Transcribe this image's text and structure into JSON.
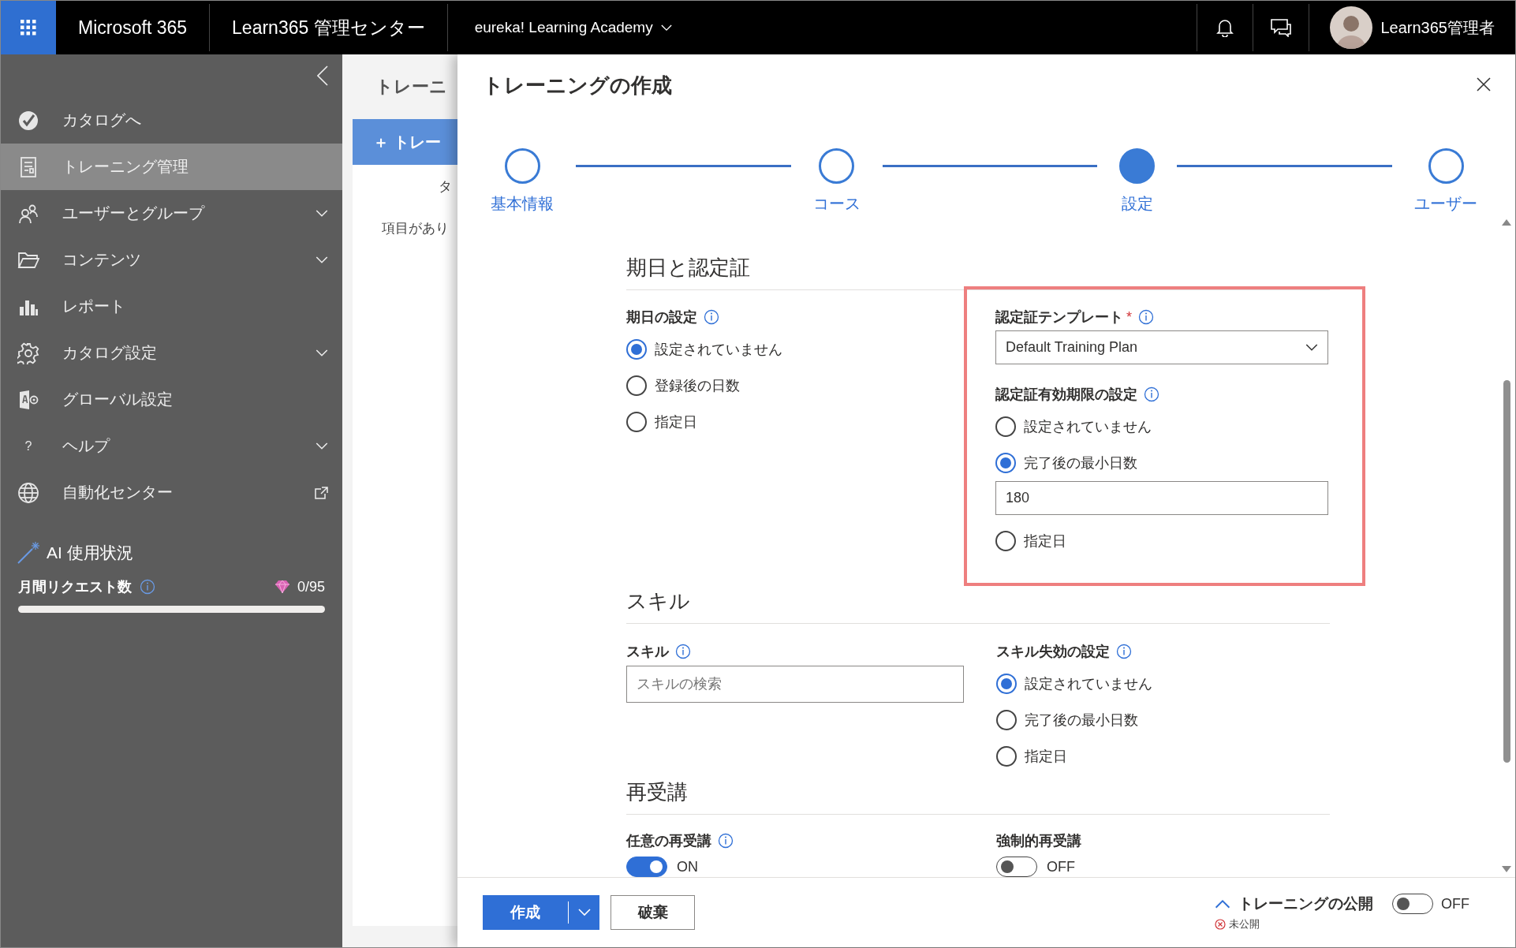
{
  "topbar": {
    "app_name": "Microsoft 365",
    "center_name": "Learn365 管理センター",
    "tenant": "eureka! Learning Academy",
    "user_name": "Learn365管理者"
  },
  "sidebar": {
    "items": [
      {
        "label": "カタログへ",
        "kind": "check",
        "selected": false,
        "expandable": false,
        "external": false
      },
      {
        "label": "トレーニング管理",
        "kind": "document",
        "selected": true,
        "expandable": false,
        "external": false
      },
      {
        "label": "ユーザーとグループ",
        "kind": "people",
        "selected": false,
        "expandable": true,
        "external": false
      },
      {
        "label": "コンテンツ",
        "kind": "folder",
        "selected": false,
        "expandable": true,
        "external": false
      },
      {
        "label": "レポート",
        "kind": "chart",
        "selected": false,
        "expandable": false,
        "external": false
      },
      {
        "label": "カタログ設定",
        "kind": "gear",
        "selected": false,
        "expandable": true,
        "external": false
      },
      {
        "label": "グローバル設定",
        "kind": "global",
        "selected": false,
        "expandable": false,
        "external": false
      },
      {
        "label": "ヘルプ",
        "kind": "glyph",
        "glyph": "?",
        "selected": false,
        "expandable": true,
        "external": false
      },
      {
        "label": "自動化センター",
        "kind": "globe",
        "selected": false,
        "expandable": false,
        "external": true
      }
    ],
    "ai": {
      "title": "AI 使用状況",
      "counter_label": "月間リクエスト数",
      "count": "0/95",
      "level": 0
    }
  },
  "background_page": {
    "title": "トレーニ",
    "button": "＋ トレー",
    "column_1": "タ",
    "empty_text": "項目があり"
  },
  "dialog": {
    "title": "トレーニングの作成",
    "steps": [
      {
        "label": "基本情報",
        "selected": false
      },
      {
        "label": "コース",
        "selected": false
      },
      {
        "label": "設定",
        "selected": true
      },
      {
        "label": "ユーザー",
        "selected": false
      }
    ],
    "dates_section": {
      "title": "期日と認定証",
      "due": {
        "label": "期日の設定",
        "info": true,
        "options": [
          {
            "label": "設定されていません",
            "selected": true
          },
          {
            "label": "登録後の日数",
            "selected": false
          },
          {
            "label": "指定日",
            "selected": false
          }
        ]
      },
      "certificate": {
        "highlighted": true,
        "template_label": "認定証テンプレート",
        "required_mark": "*",
        "info": true,
        "template_value": "Default Training Plan",
        "expiry_label": "認定証有効期限の設定",
        "expiry_info": true,
        "options": [
          {
            "label": "設定されていません",
            "selected": false
          },
          {
            "label": "完了後の最小日数",
            "selected": true,
            "field_value": "180"
          },
          {
            "label": "指定日",
            "selected": false
          }
        ]
      }
    },
    "skills_section": {
      "title": "スキル",
      "skill_label": "スキル",
      "info": true,
      "placeholder": "スキルの検索",
      "expiry_label": "スキル失効の設定",
      "expiry_info": true,
      "options": [
        {
          "label": "設定されていません",
          "selected": true
        },
        {
          "label": "完了後の最小日数",
          "selected": false
        },
        {
          "label": "指定日",
          "selected": false
        }
      ]
    },
    "retake_section": {
      "title": "再受講",
      "toggles": [
        {
          "label": "任意の再受講",
          "info": true,
          "on": true,
          "state_text": "ON"
        },
        {
          "label": "強制的再受講",
          "info": false,
          "on": false,
          "state_text": "OFF"
        }
      ]
    },
    "footer": {
      "create": "作成",
      "discard": "破棄",
      "publish": {
        "label": "トレーニングの公開",
        "on": false,
        "state_text": "OFF",
        "status": "未公開"
      }
    }
  }
}
